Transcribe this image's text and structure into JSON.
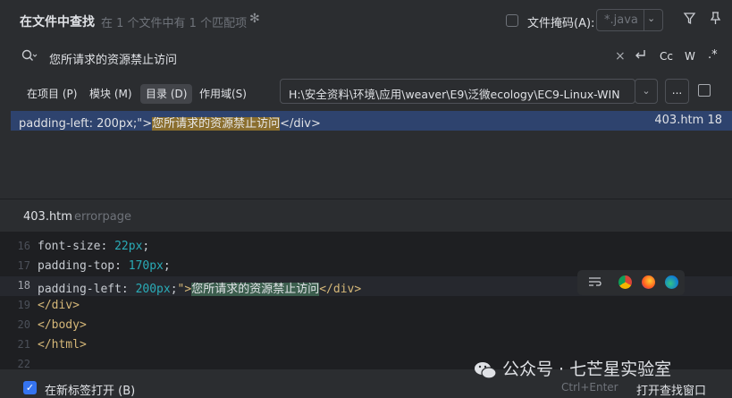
{
  "header": {
    "title": "在文件中查找",
    "subtitle": "在 1 个文件中有 1 个匹配项",
    "file_mask_label": "文件掩码(A):",
    "file_mask_value": "*.java"
  },
  "search": {
    "query": "您所请求的资源禁止访问",
    "options": {
      "case_label": "Cc",
      "word_label": "W",
      "regex_label": ".*"
    }
  },
  "scope": {
    "tabs": [
      {
        "label": "在项目 (P)"
      },
      {
        "label": "模块 (M)"
      },
      {
        "label": "目录 (D)"
      },
      {
        "label": "作用域(S)"
      }
    ],
    "path": "H:\\安全资料\\环境\\应用\\weaver\\E9\\泛微ecology\\EC9-Linux-WIN",
    "browse_label": "..."
  },
  "result": {
    "prefix": "padding-left: 200px;\">",
    "match": "您所请求的资源禁止访问",
    "suffix": "</div>",
    "location": "403.htm 18"
  },
  "preview": {
    "file": "403.htm",
    "subtitle": "errorpage",
    "lines": [
      {
        "num": "16",
        "text": "    font-size: 22px;"
      },
      {
        "num": "17",
        "text": "    padding-top: 170px;"
      },
      {
        "num": "18",
        "pre": "    padding-left: 200px;\">",
        "match": "您所请求的资源禁止访问",
        "post": "</div>"
      },
      {
        "num": "19",
        "text": "        </div>"
      },
      {
        "num": "20",
        "text": "    </body>"
      },
      {
        "num": "21",
        "text": "</html>"
      },
      {
        "num": "22",
        "text": ""
      }
    ]
  },
  "footer": {
    "open_in_new_tab": "在新标签打开 (B)",
    "shortcut_hint": "Ctrl+Enter",
    "open_find_window": "打开查找窗口"
  },
  "watermark": "公众号 · 七芒星实验室",
  "colors": {
    "accent": "#3574f0",
    "selection": "#2e436e",
    "match_highlight": "#8a6e2e",
    "preview_highlight": "#3c5e4e"
  }
}
